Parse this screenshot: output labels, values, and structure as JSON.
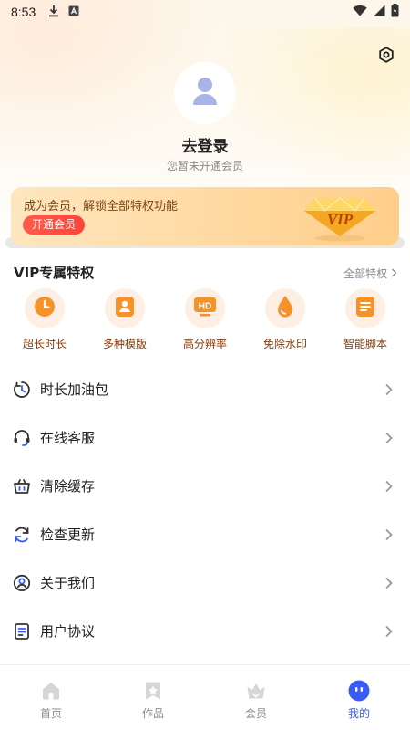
{
  "status_bar": {
    "time": "8:53",
    "icons": [
      "download-icon",
      "keyboard-a-icon",
      "wifi-icon",
      "signal-icon",
      "battery-icon"
    ]
  },
  "header": {
    "settings_icon": "gear-icon",
    "login_title": "去登录",
    "login_subtitle": "您暂未开通会员"
  },
  "vip_banner": {
    "text": "成为会员，解锁全部特权功能",
    "button_label": "开通会员",
    "badge_text": "VIP"
  },
  "privileges": {
    "title": "VIP专属特权",
    "all_link": "全部特权",
    "items": [
      {
        "label": "超长时长",
        "icon": "clock-icon"
      },
      {
        "label": "多种模版",
        "icon": "template-icon"
      },
      {
        "label": "高分辨率",
        "icon": "hd-icon"
      },
      {
        "label": "免除水印",
        "icon": "water-drop-icon"
      },
      {
        "label": "智能脚本",
        "icon": "script-icon"
      }
    ]
  },
  "menu": [
    {
      "label": "时长加油包",
      "icon": "timer-icon"
    },
    {
      "label": "在线客服",
      "icon": "headset-icon"
    },
    {
      "label": "清除缓存",
      "icon": "basket-icon"
    },
    {
      "label": "检查更新",
      "icon": "refresh-icon"
    },
    {
      "label": "关于我们",
      "icon": "user-circle-icon"
    },
    {
      "label": "用户协议",
      "icon": "document-icon"
    }
  ],
  "tabbar": {
    "tabs": [
      {
        "label": "首页",
        "icon": "home-icon",
        "active": false
      },
      {
        "label": "作品",
        "icon": "star-bookmark-icon",
        "active": false
      },
      {
        "label": "会员",
        "icon": "crown-icon",
        "active": false
      },
      {
        "label": "我的",
        "icon": "profile-face-icon",
        "active": true
      }
    ]
  },
  "colors": {
    "accent_blue": "#3a5cf5",
    "vip_orange": "#f5922a",
    "vip_button_red": "#ff4c40",
    "privilege_label": "#8a3a06"
  }
}
